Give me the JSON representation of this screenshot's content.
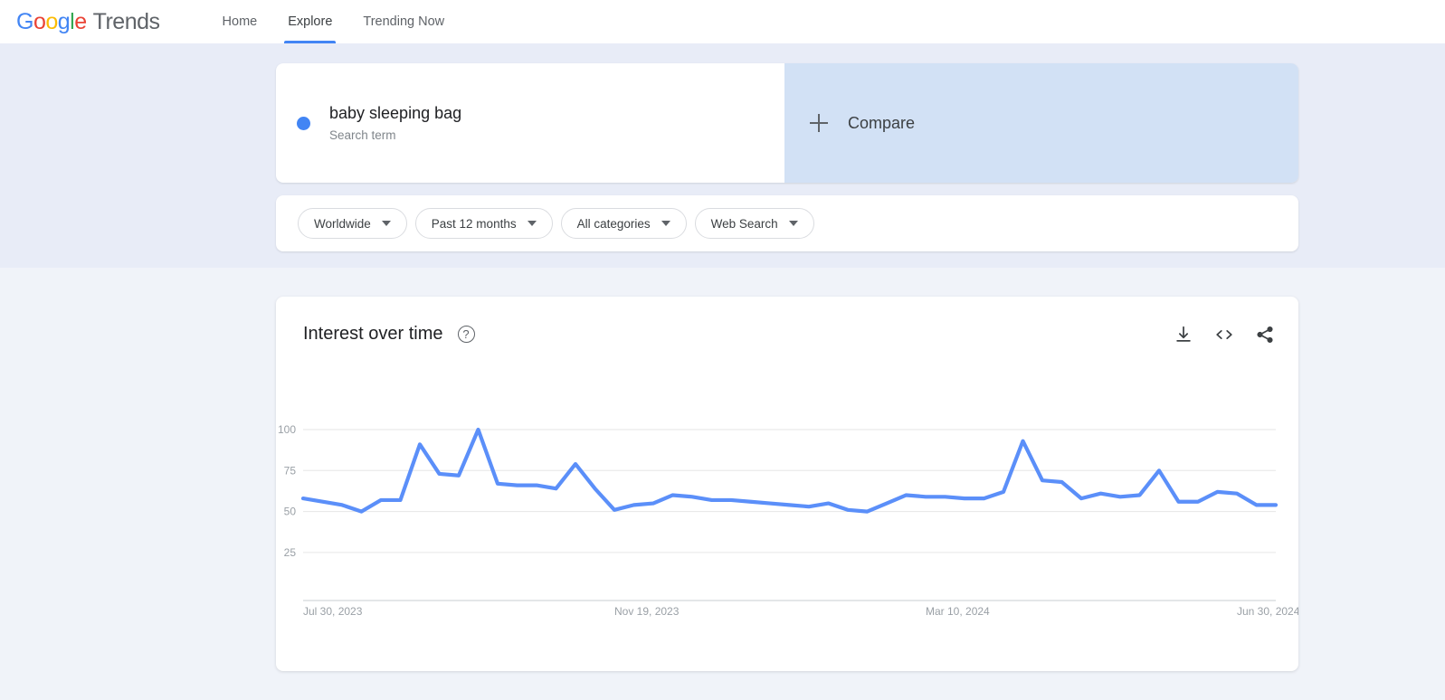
{
  "header": {
    "logo_word": "Google",
    "logo_suffix": "Trends",
    "nav": [
      {
        "label": "Home",
        "active": false
      },
      {
        "label": "Explore",
        "active": true
      },
      {
        "label": "Trending Now",
        "active": false
      }
    ]
  },
  "query": {
    "term": "baby sleeping bag",
    "term_type": "Search term",
    "term_color": "#4285F4",
    "compare_label": "Compare"
  },
  "filters": [
    {
      "label": "Worldwide"
    },
    {
      "label": "Past 12 months"
    },
    {
      "label": "All categories"
    },
    {
      "label": "Web Search"
    }
  ],
  "chart_card": {
    "title": "Interest over time",
    "help_glyph": "?",
    "actions": [
      {
        "name": "download-icon",
        "label": "Download"
      },
      {
        "name": "embed-icon",
        "label": "Embed"
      },
      {
        "name": "share-icon",
        "label": "Share"
      }
    ]
  },
  "chart_data": {
    "type": "line",
    "title": "Interest over time",
    "xlabel": "",
    "ylabel": "",
    "ylim": [
      0,
      100
    ],
    "grid": true,
    "legend": false,
    "line_color": "#5b8ff9",
    "y_ticks": [
      100,
      75,
      50,
      25
    ],
    "x_tick_labels": [
      "Jul 30, 2023",
      "Nov 19, 2023",
      "Mar 10, 2024",
      "Jun 30, 2024"
    ],
    "x_tick_indices": [
      0,
      16,
      32,
      48
    ],
    "series": [
      {
        "name": "baby sleeping bag",
        "values": [
          58,
          56,
          54,
          50,
          57,
          57,
          91,
          73,
          72,
          100,
          67,
          66,
          66,
          64,
          79,
          64,
          51,
          54,
          55,
          60,
          59,
          57,
          57,
          56,
          55,
          54,
          53,
          55,
          51,
          50,
          55,
          60,
          59,
          59,
          58,
          58,
          62,
          93,
          69,
          68,
          58,
          61,
          59,
          60,
          75,
          56,
          56,
          62,
          61,
          54,
          54
        ]
      }
    ]
  }
}
